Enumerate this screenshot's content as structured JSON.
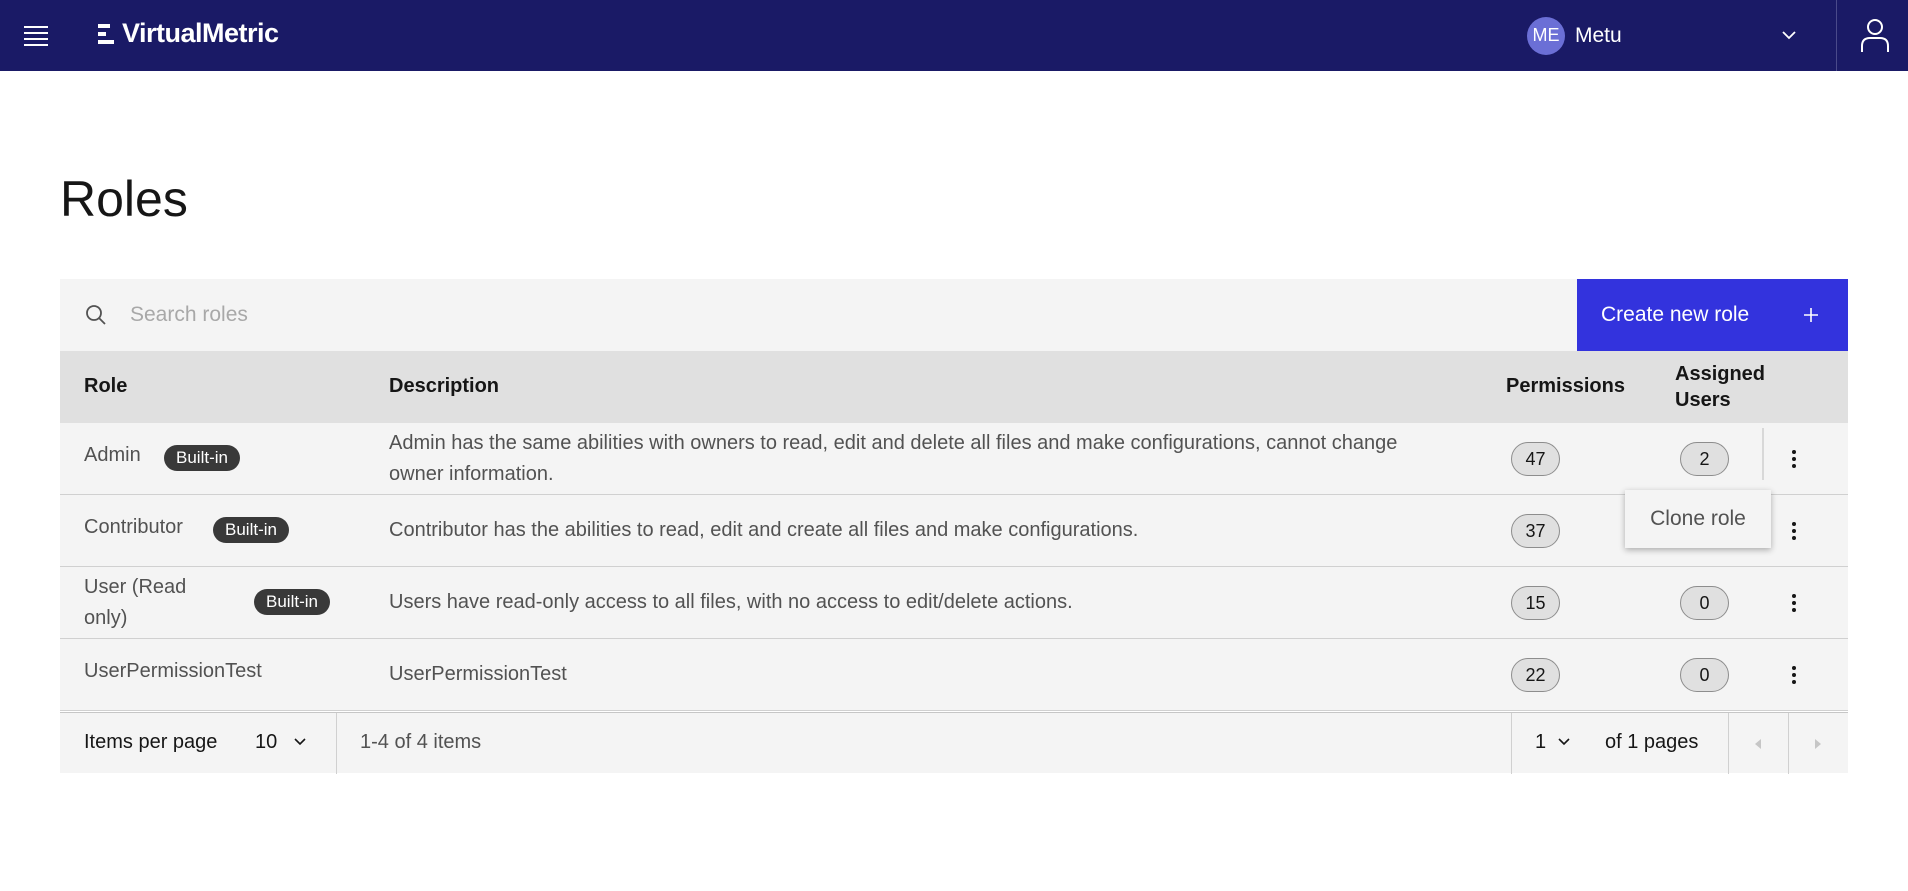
{
  "header": {
    "brand": "VirtualMetric",
    "user": {
      "initials": "ME",
      "name": "Metu"
    }
  },
  "page": {
    "title": "Roles"
  },
  "toolbar": {
    "search_placeholder": "Search roles",
    "create_label": "Create new role"
  },
  "table": {
    "columns": {
      "role": "Role",
      "description": "Description",
      "permissions": "Permissions",
      "assigned_users_line1": "Assigned",
      "assigned_users_line2": "Users"
    },
    "rows": [
      {
        "role": "Admin",
        "badge": "Built-in",
        "description": "Admin has the same abilities with owners to read, edit and delete all files and make configurations, cannot change owner information.",
        "permissions": "47",
        "assigned_users": "2"
      },
      {
        "role": "Contributor",
        "badge": "Built-in",
        "description": "Contributor has the abilities to read, edit and create all files and make configurations.",
        "permissions": "37",
        "assigned_users": ""
      },
      {
        "role": "User (Read only)",
        "badge": "Built-in",
        "description": "Users have read-only access to all files, with no access to edit/delete actions.",
        "permissions": "15",
        "assigned_users": "0"
      },
      {
        "role": "UserPermissionTest",
        "badge": "",
        "description": "UserPermissionTest",
        "permissions": "22",
        "assigned_users": "0"
      }
    ]
  },
  "overflow_menu": {
    "item": "Clone role"
  },
  "pagination": {
    "items_per_page_label": "Items per page",
    "items_per_page_value": "10",
    "range_text": "1-4 of 4 items",
    "page_value": "1",
    "pages_text": "of 1 pages"
  },
  "colors": {
    "topbar": "#1a1a66",
    "primary_button": "#3333dd",
    "badge": "#393939"
  }
}
